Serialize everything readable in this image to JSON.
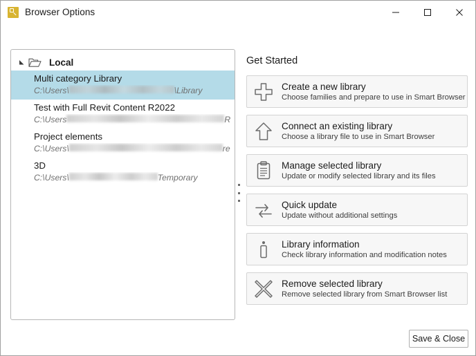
{
  "window": {
    "title": "Browser Options",
    "app_icon": "smart-browser-icon",
    "controls": {
      "minimize": "minimize-icon",
      "maximize": "maximize-icon",
      "close": "close-icon"
    }
  },
  "tree": {
    "root": {
      "label": "Local",
      "expander_icon": "expander-collapse-icon",
      "folder_icon": "open-folder-icon",
      "expanded": true
    },
    "items": [
      {
        "name": "Multi category Library",
        "path_prefix": "C:\\Users\\",
        "path_redacted": true,
        "path_suffix": "\\Library",
        "selected": true
      },
      {
        "name": "Test with Full Revit Content R2022",
        "path_prefix": "C:\\Users",
        "path_redacted": true,
        "path_suffix": "RTS\\Sm...",
        "selected": false
      },
      {
        "name": "Project elements",
        "path_prefix": "C:\\Users\\",
        "path_redacted": true,
        "path_suffix": "revit\\S...",
        "selected": false
      },
      {
        "name": "3D",
        "path_prefix": "C:\\Users\\",
        "path_redacted": true,
        "path_suffix": "Temporary",
        "selected": false
      }
    ]
  },
  "splitter": {
    "name": "panel-splitter-grip"
  },
  "get_started": {
    "heading": "Get Started",
    "actions": [
      {
        "icon": "plus-icon",
        "title": "Create a new library",
        "subtitle": "Choose families and prepare to use in Smart Browser"
      },
      {
        "icon": "up-arrow-icon",
        "title": "Connect an existing library",
        "subtitle": "Choose a library file to use in Smart Browser"
      },
      {
        "icon": "clipboard-icon",
        "title": "Manage selected library",
        "subtitle": "Update or modify selected library and its files"
      },
      {
        "icon": "swap-arrows-icon",
        "title": "Quick update",
        "subtitle": "Update without additional settings"
      },
      {
        "icon": "info-icon",
        "title": "Library information",
        "subtitle": "Check library information and modification notes"
      },
      {
        "icon": "cross-x-icon",
        "title": "Remove selected library",
        "subtitle": "Remove selected library from Smart Browser list"
      }
    ]
  },
  "footer": {
    "save_close_label": "Save & Close"
  },
  "colors": {
    "selection_highlight": "#b4dbe8",
    "app_icon": "#d8b431",
    "button_face": "#f7f7f7",
    "border": "#d3d3d3"
  }
}
